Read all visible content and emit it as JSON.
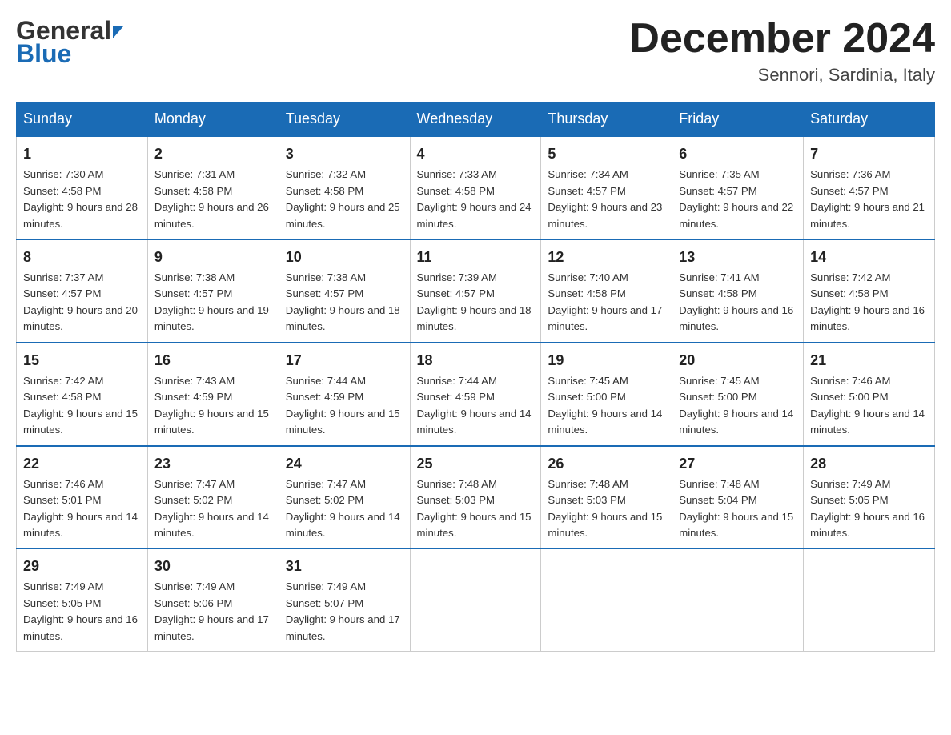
{
  "header": {
    "logo_general": "General",
    "logo_blue": "Blue",
    "month_title": "December 2024",
    "location": "Sennori, Sardinia, Italy"
  },
  "columns": [
    "Sunday",
    "Monday",
    "Tuesday",
    "Wednesday",
    "Thursday",
    "Friday",
    "Saturday"
  ],
  "weeks": [
    [
      {
        "day": "1",
        "sunrise": "7:30 AM",
        "sunset": "4:58 PM",
        "daylight": "9 hours and 28 minutes."
      },
      {
        "day": "2",
        "sunrise": "7:31 AM",
        "sunset": "4:58 PM",
        "daylight": "9 hours and 26 minutes."
      },
      {
        "day": "3",
        "sunrise": "7:32 AM",
        "sunset": "4:58 PM",
        "daylight": "9 hours and 25 minutes."
      },
      {
        "day": "4",
        "sunrise": "7:33 AM",
        "sunset": "4:58 PM",
        "daylight": "9 hours and 24 minutes."
      },
      {
        "day": "5",
        "sunrise": "7:34 AM",
        "sunset": "4:57 PM",
        "daylight": "9 hours and 23 minutes."
      },
      {
        "day": "6",
        "sunrise": "7:35 AM",
        "sunset": "4:57 PM",
        "daylight": "9 hours and 22 minutes."
      },
      {
        "day": "7",
        "sunrise": "7:36 AM",
        "sunset": "4:57 PM",
        "daylight": "9 hours and 21 minutes."
      }
    ],
    [
      {
        "day": "8",
        "sunrise": "7:37 AM",
        "sunset": "4:57 PM",
        "daylight": "9 hours and 20 minutes."
      },
      {
        "day": "9",
        "sunrise": "7:38 AM",
        "sunset": "4:57 PM",
        "daylight": "9 hours and 19 minutes."
      },
      {
        "day": "10",
        "sunrise": "7:38 AM",
        "sunset": "4:57 PM",
        "daylight": "9 hours and 18 minutes."
      },
      {
        "day": "11",
        "sunrise": "7:39 AM",
        "sunset": "4:57 PM",
        "daylight": "9 hours and 18 minutes."
      },
      {
        "day": "12",
        "sunrise": "7:40 AM",
        "sunset": "4:58 PM",
        "daylight": "9 hours and 17 minutes."
      },
      {
        "day": "13",
        "sunrise": "7:41 AM",
        "sunset": "4:58 PM",
        "daylight": "9 hours and 16 minutes."
      },
      {
        "day": "14",
        "sunrise": "7:42 AM",
        "sunset": "4:58 PM",
        "daylight": "9 hours and 16 minutes."
      }
    ],
    [
      {
        "day": "15",
        "sunrise": "7:42 AM",
        "sunset": "4:58 PM",
        "daylight": "9 hours and 15 minutes."
      },
      {
        "day": "16",
        "sunrise": "7:43 AM",
        "sunset": "4:59 PM",
        "daylight": "9 hours and 15 minutes."
      },
      {
        "day": "17",
        "sunrise": "7:44 AM",
        "sunset": "4:59 PM",
        "daylight": "9 hours and 15 minutes."
      },
      {
        "day": "18",
        "sunrise": "7:44 AM",
        "sunset": "4:59 PM",
        "daylight": "9 hours and 14 minutes."
      },
      {
        "day": "19",
        "sunrise": "7:45 AM",
        "sunset": "5:00 PM",
        "daylight": "9 hours and 14 minutes."
      },
      {
        "day": "20",
        "sunrise": "7:45 AM",
        "sunset": "5:00 PM",
        "daylight": "9 hours and 14 minutes."
      },
      {
        "day": "21",
        "sunrise": "7:46 AM",
        "sunset": "5:00 PM",
        "daylight": "9 hours and 14 minutes."
      }
    ],
    [
      {
        "day": "22",
        "sunrise": "7:46 AM",
        "sunset": "5:01 PM",
        "daylight": "9 hours and 14 minutes."
      },
      {
        "day": "23",
        "sunrise": "7:47 AM",
        "sunset": "5:02 PM",
        "daylight": "9 hours and 14 minutes."
      },
      {
        "day": "24",
        "sunrise": "7:47 AM",
        "sunset": "5:02 PM",
        "daylight": "9 hours and 14 minutes."
      },
      {
        "day": "25",
        "sunrise": "7:48 AM",
        "sunset": "5:03 PM",
        "daylight": "9 hours and 15 minutes."
      },
      {
        "day": "26",
        "sunrise": "7:48 AM",
        "sunset": "5:03 PM",
        "daylight": "9 hours and 15 minutes."
      },
      {
        "day": "27",
        "sunrise": "7:48 AM",
        "sunset": "5:04 PM",
        "daylight": "9 hours and 15 minutes."
      },
      {
        "day": "28",
        "sunrise": "7:49 AM",
        "sunset": "5:05 PM",
        "daylight": "9 hours and 16 minutes."
      }
    ],
    [
      {
        "day": "29",
        "sunrise": "7:49 AM",
        "sunset": "5:05 PM",
        "daylight": "9 hours and 16 minutes."
      },
      {
        "day": "30",
        "sunrise": "7:49 AM",
        "sunset": "5:06 PM",
        "daylight": "9 hours and 17 minutes."
      },
      {
        "day": "31",
        "sunrise": "7:49 AM",
        "sunset": "5:07 PM",
        "daylight": "9 hours and 17 minutes."
      },
      null,
      null,
      null,
      null
    ]
  ]
}
